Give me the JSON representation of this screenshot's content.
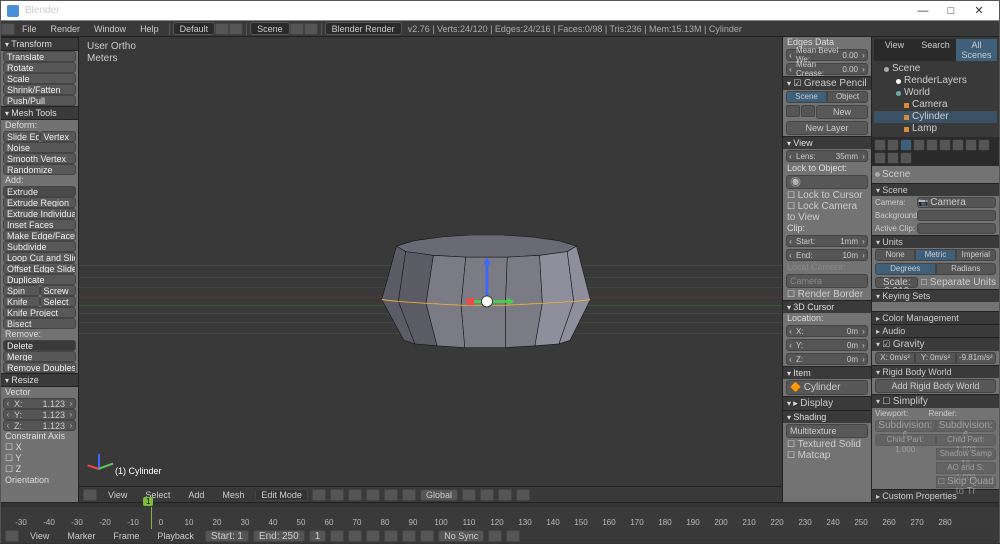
{
  "window": {
    "title": "Blender",
    "min": "—",
    "max": "□",
    "close": "✕"
  },
  "menu": {
    "file": "File",
    "render": "Render",
    "window": "Window",
    "help": "Help",
    "layout": "Default",
    "scene": "Scene",
    "engine": "Blender Render",
    "stats": "v2.76 | Verts:24/120 | Edges:24/216 | Faces:0/98 | Tris:236 | Mem:15.13M | Cylinder"
  },
  "vpinfo": {
    "l1": "User Ortho",
    "l2": "Meters",
    "obj": "(1) Cylinder"
  },
  "tools": {
    "transform_h": "Transform",
    "translate": "Translate",
    "rotate": "Rotate",
    "scale": "Scale",
    "shrink": "Shrink/Fatten",
    "pushpull": "Push/Pull",
    "mesh_h": "Mesh Tools",
    "deform": "Deform:",
    "slideedge": "Slide Ed",
    "vertex": "Vertex",
    "noise": "Noise",
    "smoothv": "Smooth Vertex",
    "randomize": "Randomize",
    "add": "Add:",
    "extrude": "Extrude",
    "extruder": "Extrude Region",
    "extrudei": "Extrude Individual",
    "inset": "Inset Faces",
    "makeedge": "Make Edge/Face",
    "subdivide": "Subdivide",
    "loopcut": "Loop Cut and Slide",
    "offsetedge": "Offset Edge Slide",
    "duplicate": "Duplicate",
    "spin": "Spin",
    "screw": "Screw",
    "knife": "Knife",
    "select": "Select",
    "knifeproj": "Knife Project",
    "bisect": "Bisect",
    "remove": "Remove:",
    "delete": "Delete",
    "merge": "Merge",
    "removedbl": "Remove Doubles",
    "resize_h": "Resize",
    "vector": "Vector",
    "v": "1.123",
    "caxis_h": "Constraint Axis",
    "orient": "Orientation"
  },
  "vp_toolbar": {
    "view": "View",
    "select": "Select",
    "add": "Add",
    "mesh": "Mesh",
    "mode": "Edit Mode",
    "orient": "Global"
  },
  "npanel": {
    "edgedata": "Edges Data",
    "bevel_l": "Mean Bevel We:",
    "bevel_v": "0.00",
    "crease_l": "Mean Crease:",
    "crease_v": "0.00",
    "gp": "Grease Pencil",
    "scene": "Scene",
    "object": "Object",
    "new": "New",
    "newlayer": "New Layer",
    "view_h": "View",
    "lens_l": "Lens:",
    "lens_v": "35mm",
    "locklbl": "Lock to Object:",
    "ltc": "Lock to Cursor",
    "lctv": "Lock Camera to View",
    "clip": "Clip:",
    "start_l": "Start:",
    "start_v": "1mm",
    "end_l": "End:",
    "end_v": "10m",
    "localcam": "Local Camera:",
    "camera": "Camera",
    "rborder": "Render Border",
    "c3d": "3D Cursor",
    "loc": "Location:",
    "zero": "0m",
    "item_h": "Item",
    "cyl": "Cylinder",
    "display_h": "Display",
    "shading_h": "Shading",
    "multitex": "Multitexture",
    "texsolid": "Textured Solid",
    "matcap": "Matcap"
  },
  "outliner": {
    "view": "View",
    "search": "Search",
    "all": "All Scenes",
    "scene": "Scene",
    "rl": "RenderLayers",
    "world": "World",
    "camera": "Camera",
    "cyl": "Cylinder",
    "lamp": "Lamp"
  },
  "props": {
    "scene_h": "Scene",
    "camera_l": "Camera:",
    "camera_v": "Camera",
    "bg_l": "Background:",
    "clip_l": "Active Clip:",
    "units_h": "Units",
    "none": "None",
    "metric": "Metric",
    "imperial": "Imperial",
    "degrees": "Degrees",
    "radians": "Radians",
    "scale_l": "Scale:",
    "scale_v": "0.010",
    "sepunits": "Separate Units",
    "keying_h": "Keying Sets",
    "cm_h": "Color Management",
    "audio_h": "Audio",
    "grav_h": "Gravity",
    "gx": "X: 0m/s²",
    "gy": "Y: 0m/s²",
    "gz": "-9.81m/s²",
    "rbw_h": "Rigid Body World",
    "addrbw": "Add Rigid Body World",
    "simp_h": "Simplify",
    "vp": "Viewport:",
    "rn": "Render:",
    "subd": "Subdivision:",
    "subdv": "6",
    "child": "Child Part: 1.000",
    "shadow": "Shadow Samp 16",
    "ao": "AO and S: 1.000",
    "skip": "Skip Quad to Tr",
    "custom_h": "Custom Properties"
  },
  "timeline": {
    "ticks": [
      "-30",
      "-40",
      "-30",
      "-20",
      "-10",
      "0",
      "10",
      "20",
      "30",
      "40",
      "50",
      "60",
      "70",
      "80",
      "90",
      "100",
      "110",
      "120",
      "130",
      "140",
      "150",
      "160",
      "170",
      "180",
      "190",
      "200",
      "210",
      "220",
      "230",
      "240",
      "250",
      "260",
      "270",
      "280"
    ],
    "cursor": "1",
    "view": "View",
    "marker": "Marker",
    "frame": "Frame",
    "playback": "Playback",
    "start_l": "Start:",
    "start_v": "1",
    "end_l": "End:",
    "end_v": "250",
    "nosync": "No Sync"
  },
  "chart_data": {
    "type": "table",
    "title": "3D cursor location",
    "rows": [
      [
        "X",
        "0m"
      ],
      [
        "Y",
        "0m"
      ],
      [
        "Z",
        "0m"
      ]
    ]
  }
}
